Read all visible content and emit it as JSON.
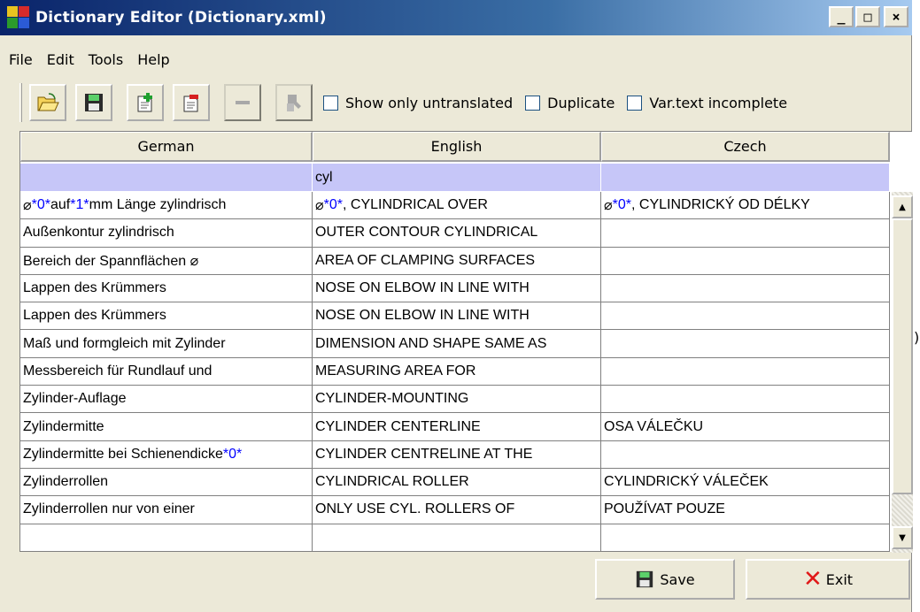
{
  "window": {
    "title": "Dictionary Editor (Dictionary.xml)",
    "min_label": "_",
    "max_label": "□",
    "close_label": "×"
  },
  "menu": {
    "items": [
      "File",
      "Edit",
      "Tools",
      "Help"
    ]
  },
  "toolbar": {
    "checkboxes": [
      {
        "label": "Show only untranslated",
        "checked": false
      },
      {
        "label": "Duplicate",
        "checked": false
      },
      {
        "label": "Var.text incomplete",
        "checked": false
      }
    ]
  },
  "table": {
    "columns": [
      "German",
      "English",
      "Czech"
    ],
    "filter": [
      "",
      "cyl",
      ""
    ],
    "rows": [
      [
        "⌀ *0* auf *1* mm Länge zylindrisch",
        "⌀ *0* , CYLINDRICAL OVER",
        "⌀ *0* , CYLINDRICKÝ OD DÉLKY"
      ],
      [
        "Außenkontur zylindrisch",
        "OUTER CONTOUR CYLINDRICAL",
        ""
      ],
      [
        "Bereich der Spannflächen ⌀",
        "AREA OF CLAMPING SURFACES",
        ""
      ],
      [
        "Lappen des Krümmers",
        "NOSE ON ELBOW IN LINE WITH",
        ""
      ],
      [
        "Lappen des Krümmers",
        "NOSE ON ELBOW IN LINE WITH",
        ""
      ],
      [
        "Maß und formgleich mit Zylinder",
        "DIMENSION AND SHAPE SAME AS",
        ""
      ],
      [
        "Messbereich für Rundlauf und",
        "MEASURING AREA FOR",
        ""
      ],
      [
        "Zylinder-Auflage",
        "CYLINDER-MOUNTING",
        ""
      ],
      [
        "Zylindermitte",
        "CYLINDER CENTERLINE",
        "OSA VÁLEČKU"
      ],
      [
        "Zylindermitte bei Schienendicke *0*",
        "CYLINDER CENTRELINE AT THE",
        ""
      ],
      [
        "Zylinderrollen",
        "CYLINDRICAL ROLLER",
        "CYLINDRICKÝ VÁLEČEK"
      ],
      [
        "Zylinderrollen nur von einer",
        "ONLY USE CYL. ROLLERS OF",
        "POUŽÍVAT POUZE"
      ],
      [
        "",
        "",
        ""
      ]
    ],
    "placeholder_color": "#0000ff",
    "filter_bg": "#c6c6f8"
  },
  "buttons": {
    "save_label": "Save",
    "exit_label": "Exit"
  },
  "stray": ")"
}
